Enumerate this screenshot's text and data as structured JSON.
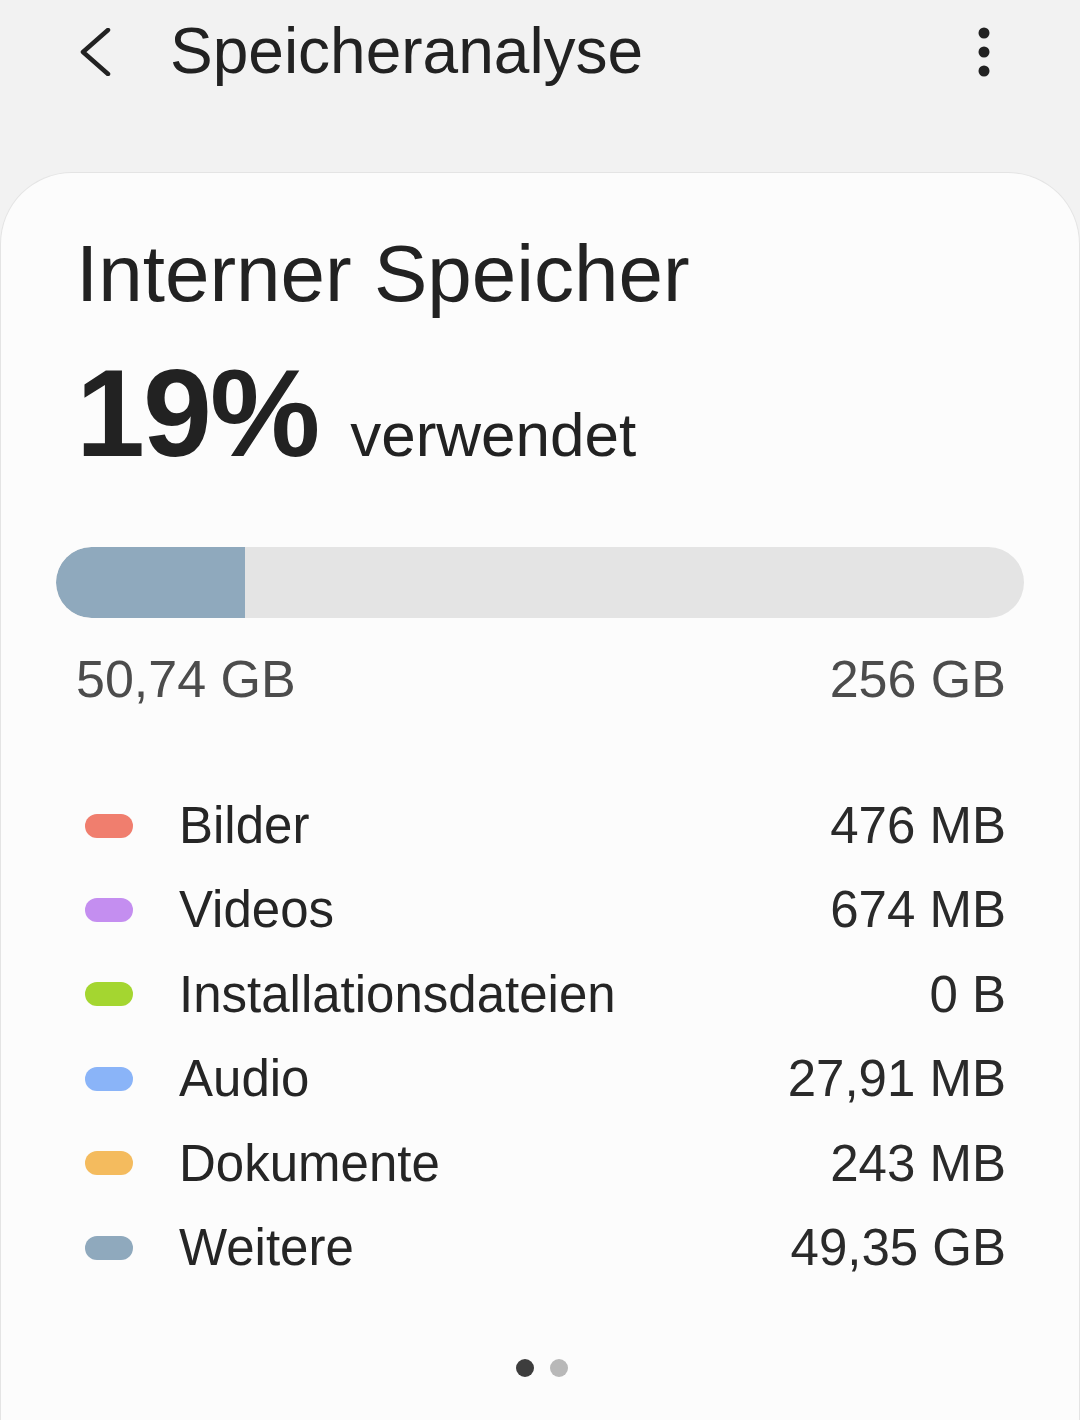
{
  "header": {
    "title": "Speicheranalyse"
  },
  "storage": {
    "title": "Interner Speicher",
    "percent": "19%",
    "percent_label": "verwendet",
    "bar": {
      "level": 0.195
    },
    "used": "50,74 GB",
    "total": "256 GB",
    "categories": [
      {
        "name": "Bilder",
        "size": "476 MB",
        "color": "#f07e6e"
      },
      {
        "name": "Videos",
        "size": "674 MB",
        "color": "#c48ef0"
      },
      {
        "name": "Installationsdateien",
        "size": "0 B",
        "color": "#a4d630"
      },
      {
        "name": "Audio",
        "size": "27,91 MB",
        "color": "#8ab4f8"
      },
      {
        "name": "Dokumente",
        "size": "243 MB",
        "color": "#f4bb5e"
      },
      {
        "name": "Weitere",
        "size": "49,35 GB",
        "color": "#8fa9bd"
      }
    ],
    "pages": [
      {
        "selected": true
      },
      {
        "selected": false
      }
    ]
  }
}
